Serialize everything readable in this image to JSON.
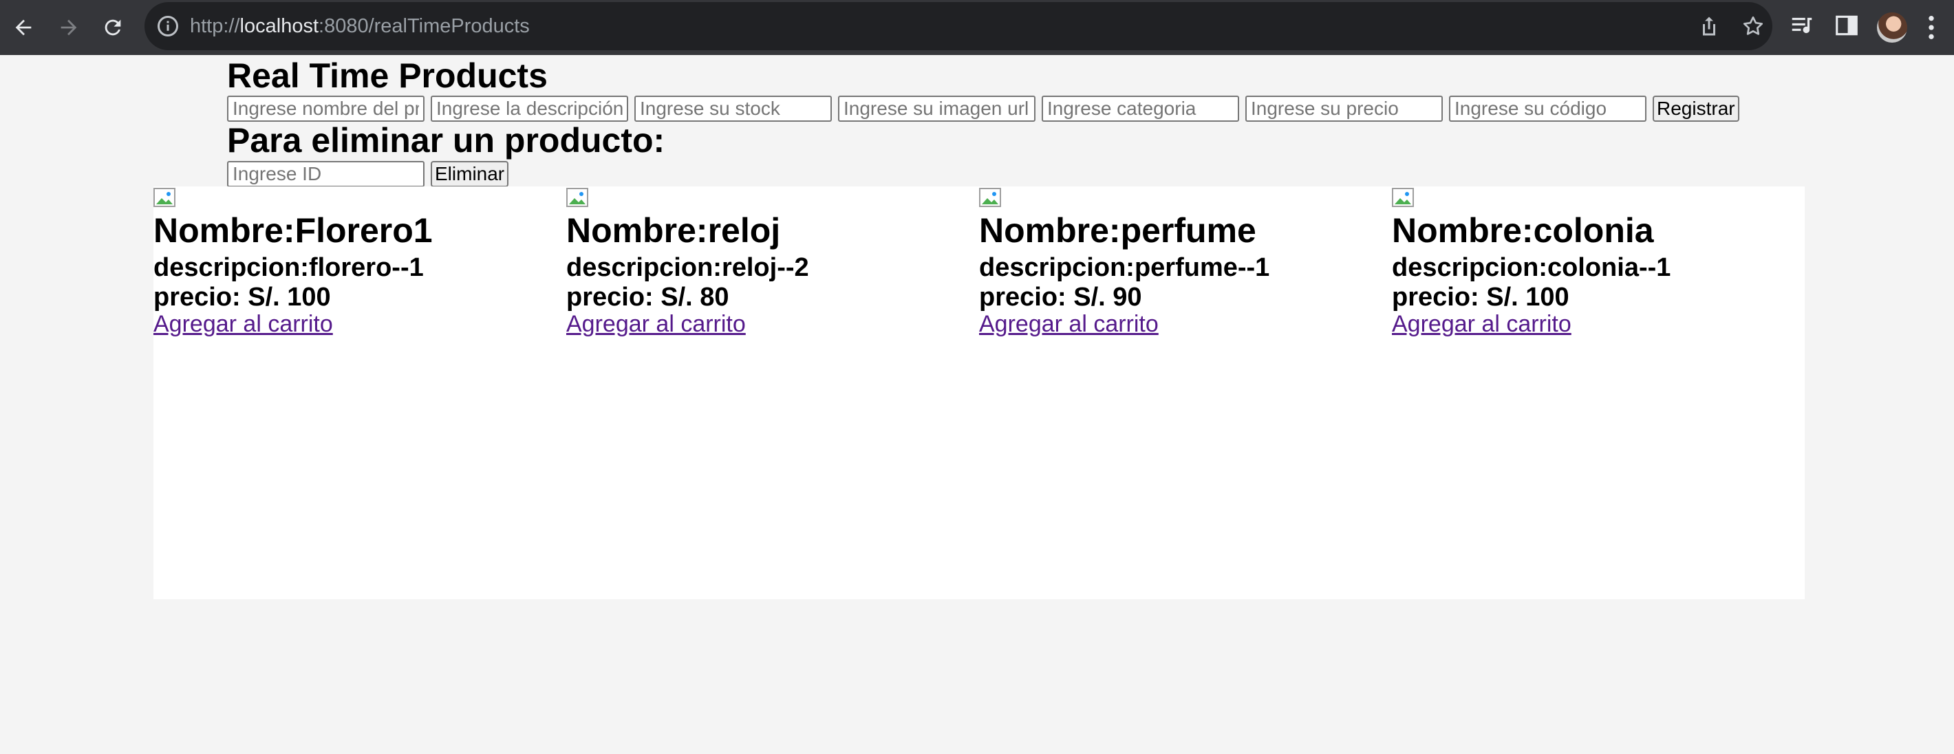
{
  "browser": {
    "url_prefix": "http://",
    "url_host": "localhost",
    "url_rest": ":8080/realTimeProducts"
  },
  "page": {
    "title": "Real Time Products",
    "register_form": {
      "name_placeholder": "Ingrese nombre del producto",
      "description_placeholder": "Ingrese la descripción",
      "stock_placeholder": "Ingrese su stock",
      "image_placeholder": "Ingrese su imagen url",
      "category_placeholder": "Ingrese categoria",
      "price_placeholder": "Ingrese su precio",
      "code_placeholder": "Ingrese su código",
      "submit_label": "Registrar"
    },
    "delete_title": "Para eliminar un producto:",
    "delete_form": {
      "id_placeholder": "Ingrese ID",
      "submit_label": "Eliminar"
    }
  },
  "products": [
    {
      "name": "Nombre:Florero1",
      "description": "descripcion:florero--1",
      "price": "precio: S/. 100",
      "cart_link": "Agregar al carrito"
    },
    {
      "name": "Nombre:reloj",
      "description": "descripcion:reloj--2",
      "price": "precio: S/. 80",
      "cart_link": "Agregar al carrito"
    },
    {
      "name": "Nombre:perfume",
      "description": "descripcion:perfume--1",
      "price": "precio: S/. 90",
      "cart_link": "Agregar al carrito"
    },
    {
      "name": "Nombre:colonia",
      "description": "descripcion:colonia--1",
      "price": "precio: S/. 100",
      "cart_link": "Agregar al carrito"
    }
  ],
  "colors": {
    "chrome_bg": "#35363a",
    "omnibox_bg": "#202124",
    "page_bg": "#f4f4f4",
    "visited_link": "#551a8b"
  }
}
